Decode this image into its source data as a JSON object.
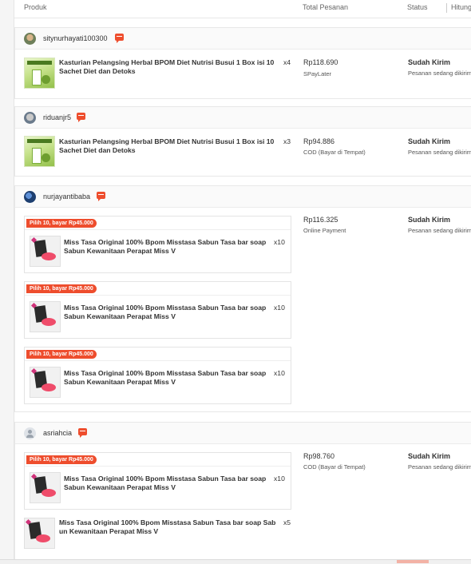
{
  "header": {
    "col_product": "Produk",
    "col_total": "Total Pesanan",
    "col_status": "Status",
    "col_countdown": "Hitungan"
  },
  "orders": [
    {
      "username": "sitynurhayati100300",
      "items": [
        {
          "title_line1": "Kasturian Pelangsing Herbal BPOM Diet Nutrisi Busui 1 Box isi 10",
          "title_line2": "Sachet Diet dan Detoks",
          "qty": "x4"
        }
      ],
      "total": "Rp118.690",
      "payment": "SPayLater",
      "status": "Sudah Kirim",
      "status_desc": "Pesanan sedang dikirim"
    },
    {
      "username": "riduanjr5",
      "items": [
        {
          "title_line1": "Kasturian Pelangsing Herbal BPOM Diet Nutrisi Busui 1 Box isi 10",
          "title_line2": "Sachet Diet dan Detoks",
          "qty": "x3"
        }
      ],
      "total": "Rp94.886",
      "payment": "COD (Bayar di Tempat)",
      "status": "Sudah Kirim",
      "status_desc": "Pesanan sedang dikirim"
    },
    {
      "username": "nurjayantibaba",
      "bundles": [
        {
          "promo": "Pilih 10, bayar Rp45.000",
          "title_line1": "Miss Tasa Original 100% Bpom Misstasa Sabun Tasa bar soap",
          "title_line2": "Sabun Kewanitaan Perapat Miss V",
          "qty": "x10"
        },
        {
          "promo": "Pilih 10, bayar Rp45.000",
          "title_line1": "Miss Tasa Original 100% Bpom Misstasa Sabun Tasa bar soap",
          "title_line2": "Sabun Kewanitaan Perapat Miss V",
          "qty": "x10"
        },
        {
          "promo": "Pilih 10, bayar Rp45.000",
          "title_line1": "Miss Tasa Original 100% Bpom Misstasa Sabun Tasa bar soap",
          "title_line2": "Sabun Kewanitaan Perapat Miss V",
          "qty": "x10"
        }
      ],
      "total": "Rp116.325",
      "payment": "Online Payment",
      "status": "Sudah Kirim",
      "status_desc": "Pesanan sedang dikirim"
    },
    {
      "username": "asriahcia",
      "bundles": [
        {
          "promo": "Pilih 10, bayar Rp45.000",
          "title_line1": "Miss Tasa Original 100% Bpom Misstasa Sabun Tasa bar soap",
          "title_line2": "Sabun Kewanitaan Perapat Miss V",
          "qty": "x10"
        }
      ],
      "items": [
        {
          "title_line1": "Miss Tasa Original 100% Bpom Misstasa Sabun Tasa bar soap Sab",
          "title_line2": "un Kewanitaan Perapat Miss V",
          "qty": "x5"
        }
      ],
      "total": "Rp98.760",
      "payment": "COD (Bayar di Tempat)",
      "status": "Sudah Kirim",
      "status_desc": "Pesanan sedang dikirim"
    }
  ]
}
